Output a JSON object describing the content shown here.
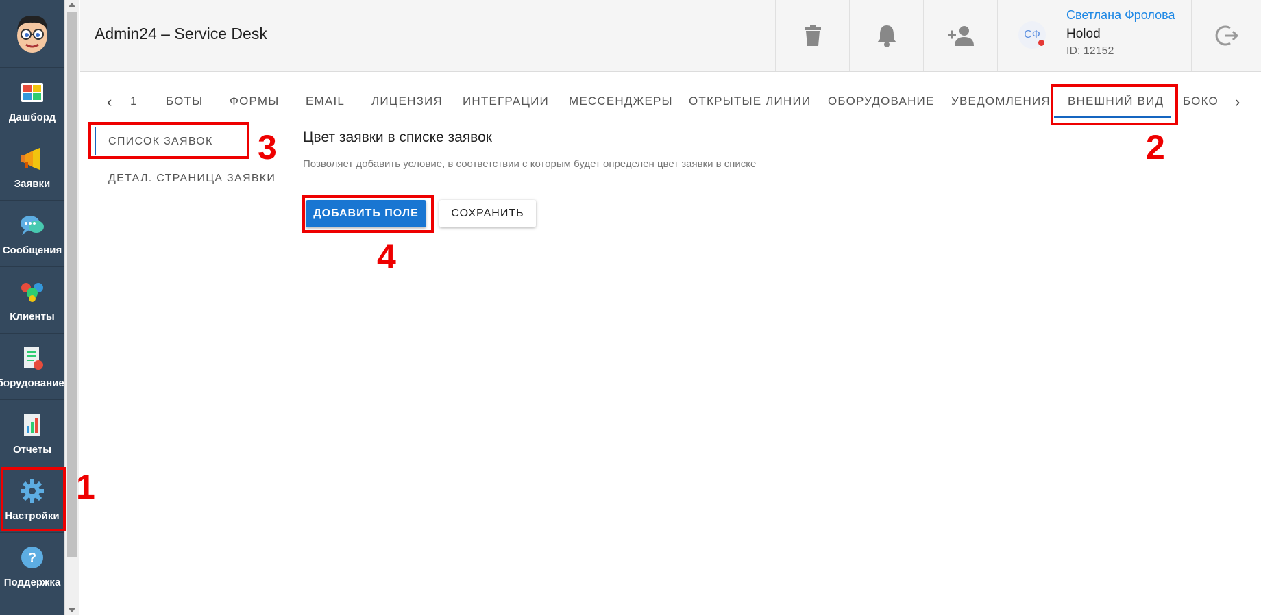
{
  "nav": {
    "items": [
      {
        "label": "Дашборд",
        "icon": "dashboard-icon"
      },
      {
        "label": "Заявки",
        "icon": "megaphone-icon"
      },
      {
        "label": "Сообщения",
        "icon": "chat-bubbles-icon"
      },
      {
        "label": "Клиенты",
        "icon": "clients-icon"
      },
      {
        "label": "Оборудование",
        "icon": "equipment-icon"
      },
      {
        "label": "Отчеты",
        "icon": "reports-icon"
      },
      {
        "label": "Настройки",
        "icon": "gear-icon"
      },
      {
        "label": "Поддержка",
        "icon": "help-icon"
      }
    ]
  },
  "header": {
    "title": "Admin24 – Service Desk",
    "user": {
      "initials": "СФ",
      "name": "Светлана Фролова",
      "org": "Holod",
      "id": "ID: 12152"
    }
  },
  "tabs": {
    "page": "1",
    "items": [
      "БОТЫ",
      "ФОРМЫ",
      "EMAIL",
      "ЛИЦЕНЗИЯ",
      "ИНТЕГРАЦИИ",
      "МЕССЕНДЖЕРЫ",
      "ОТКРЫТЫЕ ЛИНИИ",
      "ОБОРУДОВАНИЕ",
      "УВЕДОМЛЕНИЯ",
      "ВНЕШНИЙ ВИД",
      "БОКО"
    ],
    "active": "ВНЕШНИЙ ВИД"
  },
  "subnav": {
    "items": [
      "СПИСОК ЗАЯВОК",
      "ДЕТАЛ. СТРАНИЦА ЗАЯВКИ"
    ],
    "active": "СПИСОК ЗАЯВОК"
  },
  "content": {
    "title": "Цвет заявки в списке заявок",
    "description": "Позволяет добавить условие, в соответствии с которым будет определен цвет заявки в списке",
    "add_button": "ДОБАВИТЬ ПОЛЕ",
    "save_button": "СОХРАНИТЬ"
  },
  "annotations": {
    "n1": "1",
    "n2": "2",
    "n3": "3",
    "n4": "4",
    "color": "#ee0000"
  },
  "colors": {
    "nav_bg": "#34495e",
    "accent": "#1976d2",
    "link": "#1e88e5"
  }
}
